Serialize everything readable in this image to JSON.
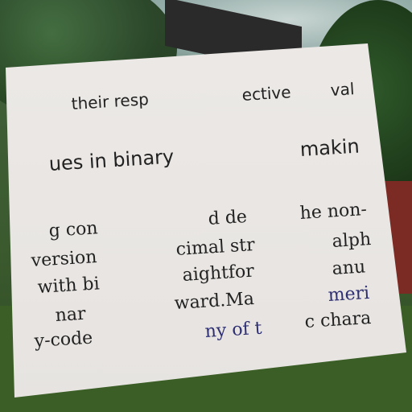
{
  "text_lines": {
    "l1": "their resp",
    "l2": "ective",
    "l3": "val",
    "l4": "ues in binary",
    "l5": "makin",
    "c1a": "g con",
    "c1b": "version",
    "c1c": "with bi",
    "c1d": "nar",
    "c1e": "y-code",
    "c2a": "d de",
    "c2b": "cimal str",
    "c2c": "aightfor",
    "c2d": "ward.Ma",
    "c2e": "ny of t",
    "c3a": "he non-",
    "c3b": "alph",
    "c3c": "anu",
    "c3d": "meri",
    "c3e": "c chara"
  },
  "colors": {
    "paper": "#e8e5e2",
    "ink": "#222222",
    "blue_ink": "#2e2f73"
  }
}
